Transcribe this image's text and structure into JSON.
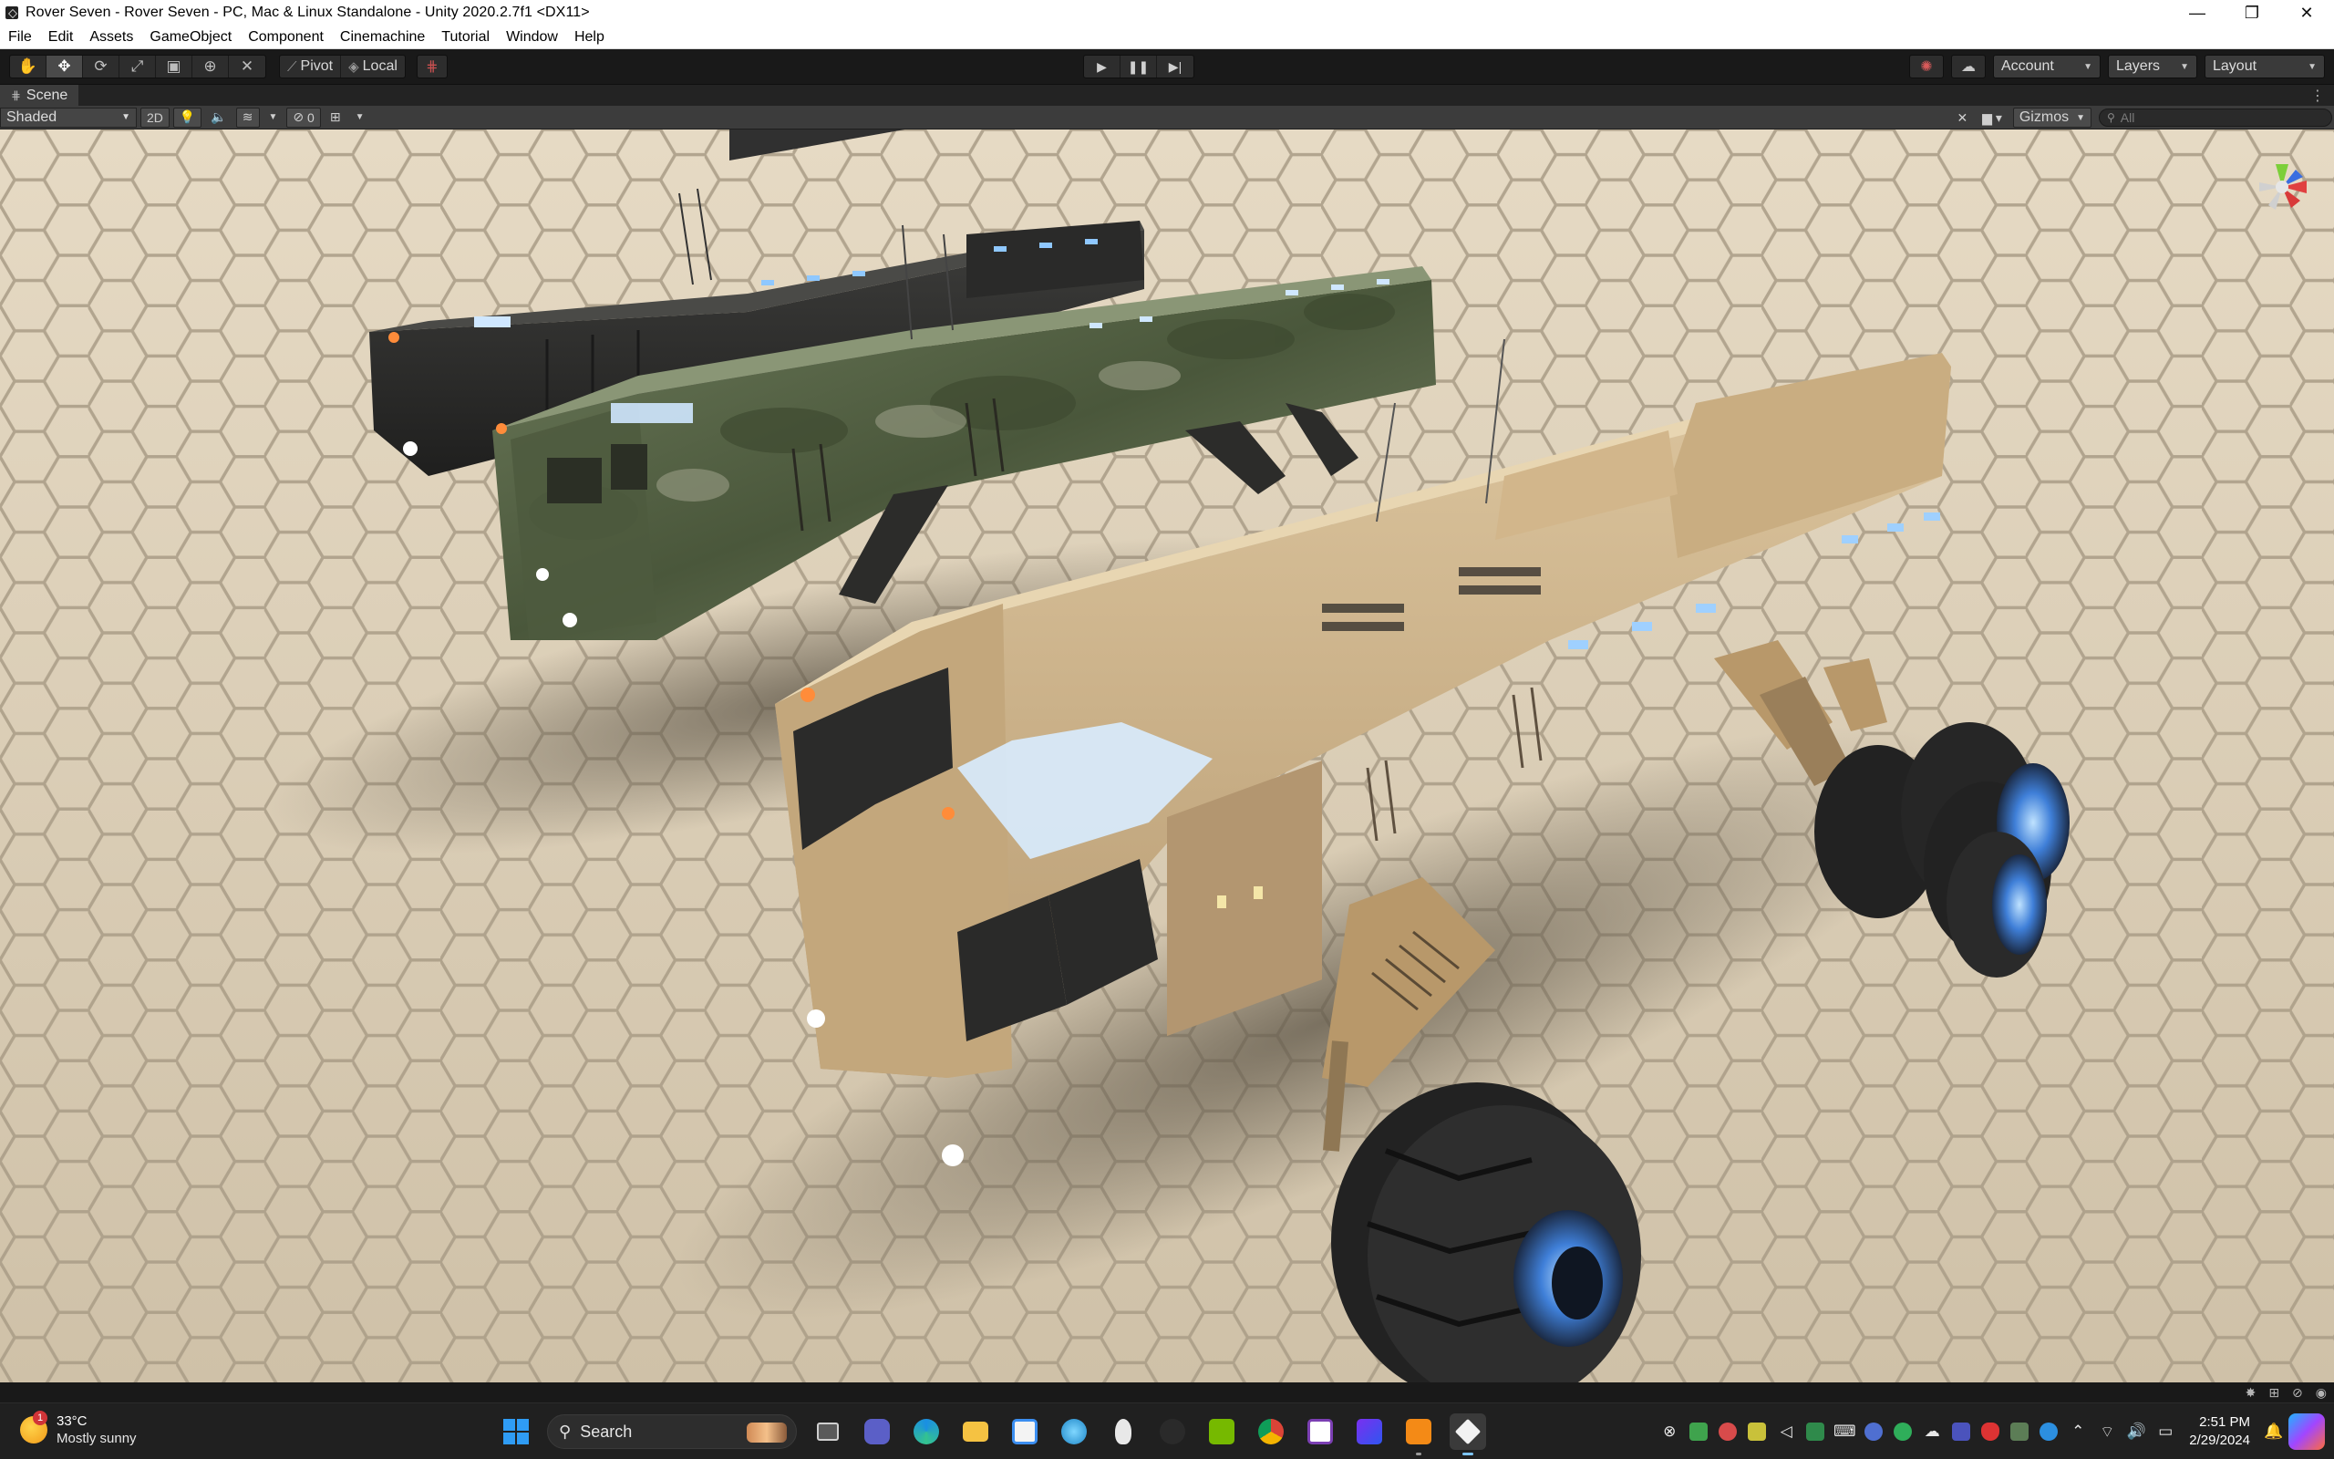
{
  "window": {
    "title": "Rover Seven - Rover Seven - PC, Mac & Linux Standalone - Unity 2020.2.7f1 <DX11>",
    "minimize_label": "—",
    "restore_label": "❐",
    "close_label": "✕"
  },
  "menu": [
    "File",
    "Edit",
    "Assets",
    "GameObject",
    "Component",
    "Cinemachine",
    "Tutorial",
    "Window",
    "Help"
  ],
  "toolbar": {
    "tools": [
      {
        "name": "hand-tool-icon",
        "glyph": "✋"
      },
      {
        "name": "move-tool-icon",
        "glyph": "✥"
      },
      {
        "name": "rotate-tool-icon",
        "glyph": "⟳"
      },
      {
        "name": "scale-tool-icon",
        "glyph": "⤢"
      },
      {
        "name": "rect-tool-icon",
        "glyph": "▣"
      },
      {
        "name": "transform-tool-icon",
        "glyph": "⊕"
      },
      {
        "name": "custom-tool-icon",
        "glyph": "✕"
      }
    ],
    "pivot_label": "Pivot",
    "local_label": "Local",
    "play_icons": [
      "▶",
      "❚❚",
      "▶|"
    ],
    "account_label": "Account",
    "layers_label": "Layers",
    "layout_label": "Layout"
  },
  "scene": {
    "tab_label": "Scene",
    "shading_mode": "Shaded",
    "mode_2d_label": "2D",
    "hidden_count": "0",
    "gizmos_label": "Gizmos",
    "search_placeholder": "All"
  },
  "viewport": {
    "ground_color": "#d9cdb7",
    "rovers": [
      {
        "name": "black-rover",
        "body_color": "#2d2d2c"
      },
      {
        "name": "camo-rover",
        "body_color": "#4f5a3e"
      },
      {
        "name": "desert-rover",
        "body_color": "#cdb48c"
      }
    ],
    "accent_light": "#9fd0ff"
  },
  "taskbar": {
    "weather_temp": "33°C",
    "weather_condition": "Mostly sunny",
    "weather_badge": "1",
    "search_label": "Search",
    "time": "2:51 PM",
    "date": "2/29/2024"
  }
}
